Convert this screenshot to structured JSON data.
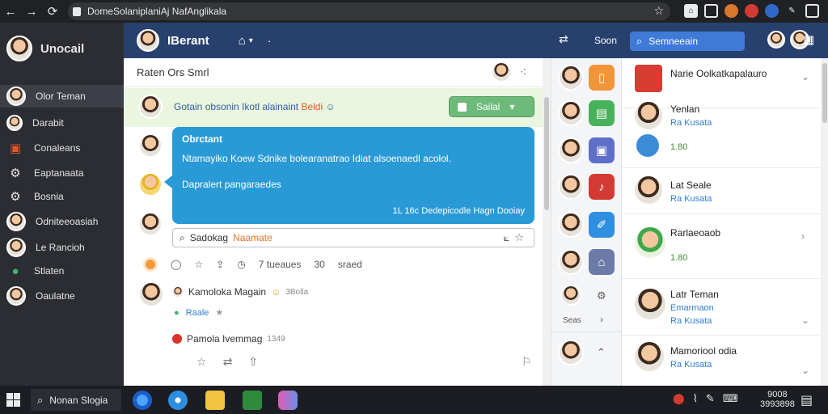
{
  "browser": {
    "url": "DomeSolaniplaniAj NafAnglikala",
    "back": "←",
    "forward": "→",
    "reload": "⟳",
    "bookmark": "☆"
  },
  "sidebar": {
    "title": "Unocail",
    "items": [
      {
        "label": "Olor Teman"
      },
      {
        "label": "Darabit"
      },
      {
        "label": "Conaleans"
      },
      {
        "label": "Eaptanaata"
      },
      {
        "label": "Bosnia"
      },
      {
        "label": "Odniteeoasiah"
      },
      {
        "label": "Le Rancioh"
      },
      {
        "label": "Stlaten"
      },
      {
        "label": "Oaulatne"
      }
    ]
  },
  "header": {
    "brand": "IBerant",
    "soon": "Soon",
    "search_placeholder": "Semneeain"
  },
  "chat": {
    "title": "Raten Ors Smrl",
    "pinned": {
      "text": "Gotain obsonin Ikotl alainaint",
      "highlight": "Beldi",
      "button": "Sailal"
    },
    "bubble": {
      "title": "Obrctant",
      "body": "Ntamayiko Koew Sdnike bolearanatrao Idiat alsoenaedl acolol.",
      "sub": "Dapralert pangaraedes",
      "footer": "1L 16c Dedepicodle Hagn Dooiay"
    },
    "compose": {
      "label": "Sadokag",
      "placeholder": "Naamate"
    },
    "reactions": {
      "time": "7 tueaues",
      "count": "30",
      "unit": "sraed"
    },
    "thread": {
      "name": "Kamoloka Magain",
      "time": "3Bolla",
      "meta": "Raale"
    },
    "reply": {
      "name": "Pamola Ivemmag",
      "time": "1349"
    }
  },
  "rail": {
    "label": "Seas"
  },
  "contacts": [
    {
      "name": "Narie Oolkatkapalauro"
    },
    {
      "name": "Yenlan",
      "sub": "Ra Kusata",
      "score": "1.80"
    },
    {
      "name": "Lat Seale",
      "sub": "Ra Kusata"
    },
    {
      "name": "Rarlaeoaob",
      "score": "1.80"
    },
    {
      "name": "Latr Teman",
      "sub": "Emarmaon",
      "sub2": "Ra Kusata"
    },
    {
      "name": "Mamoriool odia",
      "sub": "Ra Kusata"
    }
  ],
  "taskbar": {
    "search": "Nonan Slogia",
    "time": "9008",
    "date": "3993898"
  },
  "colors": {
    "sidebar": "#2b2d33",
    "header": "#27406e",
    "bubble": "#2a9ad6",
    "pin_bg": "#eaf6df",
    "pin_button": "#6dba7a"
  }
}
